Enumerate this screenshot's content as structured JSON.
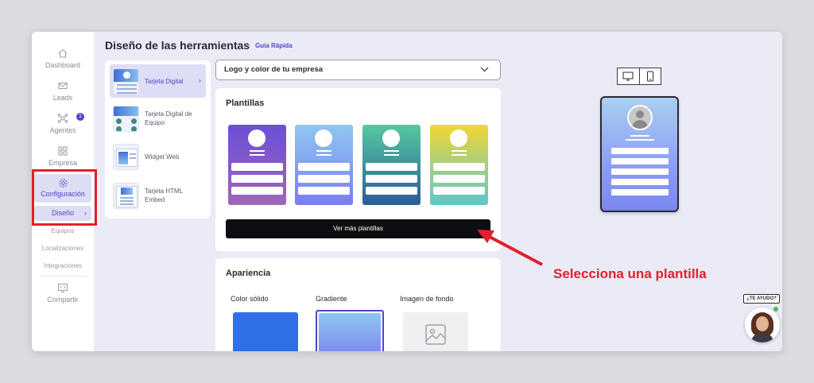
{
  "sidebar": {
    "items": [
      {
        "label": "Dashboard",
        "icon": "home-icon"
      },
      {
        "label": "Leads",
        "icon": "mail-icon"
      },
      {
        "label": "Agentes",
        "icon": "network-icon",
        "badge": "1"
      },
      {
        "label": "Empresa",
        "icon": "grid-icon"
      },
      {
        "label": "Configuración",
        "icon": "gear-icon"
      }
    ],
    "sub_items": [
      "Diseño",
      "Equipos",
      "Localizaciones",
      "Integraciones"
    ],
    "share_label": "Compartir"
  },
  "header": {
    "title": "Diseño de las herramientas",
    "guide_link": "Guía Rápida"
  },
  "tools": [
    {
      "label": "Tarjeta Digital"
    },
    {
      "label": "Tarjeta Digital de Equipo"
    },
    {
      "label": "Widget Web"
    },
    {
      "label": "Tarjeta HTML Embed"
    }
  ],
  "dropdown": {
    "value": "Logo y color de tu empresa"
  },
  "templates": {
    "title": "Plantillas",
    "more_button": "Ver más plantillas",
    "gradients": [
      "#6b4fd8|#a067b8",
      "#8fc7f0|#7b7ef0",
      "#56c8a0|#2b5d98",
      "#f2d633|#5ec6c8"
    ]
  },
  "appearance": {
    "title": "Apariencia",
    "options": [
      {
        "label": "Color sólido",
        "color": "#2f6fe8"
      },
      {
        "label": "Gradiente",
        "color": "#8fc7f0|#7b86f0"
      },
      {
        "label": "Imagen de fondo",
        "color": "#f0f0f2"
      }
    ]
  },
  "annotation": {
    "text": "Selecciona una plantilla",
    "color": "#e21f2b"
  },
  "help": {
    "label": "¿TE AYUDO?"
  },
  "colors": {
    "accent": "#4f46c8",
    "highlight": "#e21f2b"
  }
}
